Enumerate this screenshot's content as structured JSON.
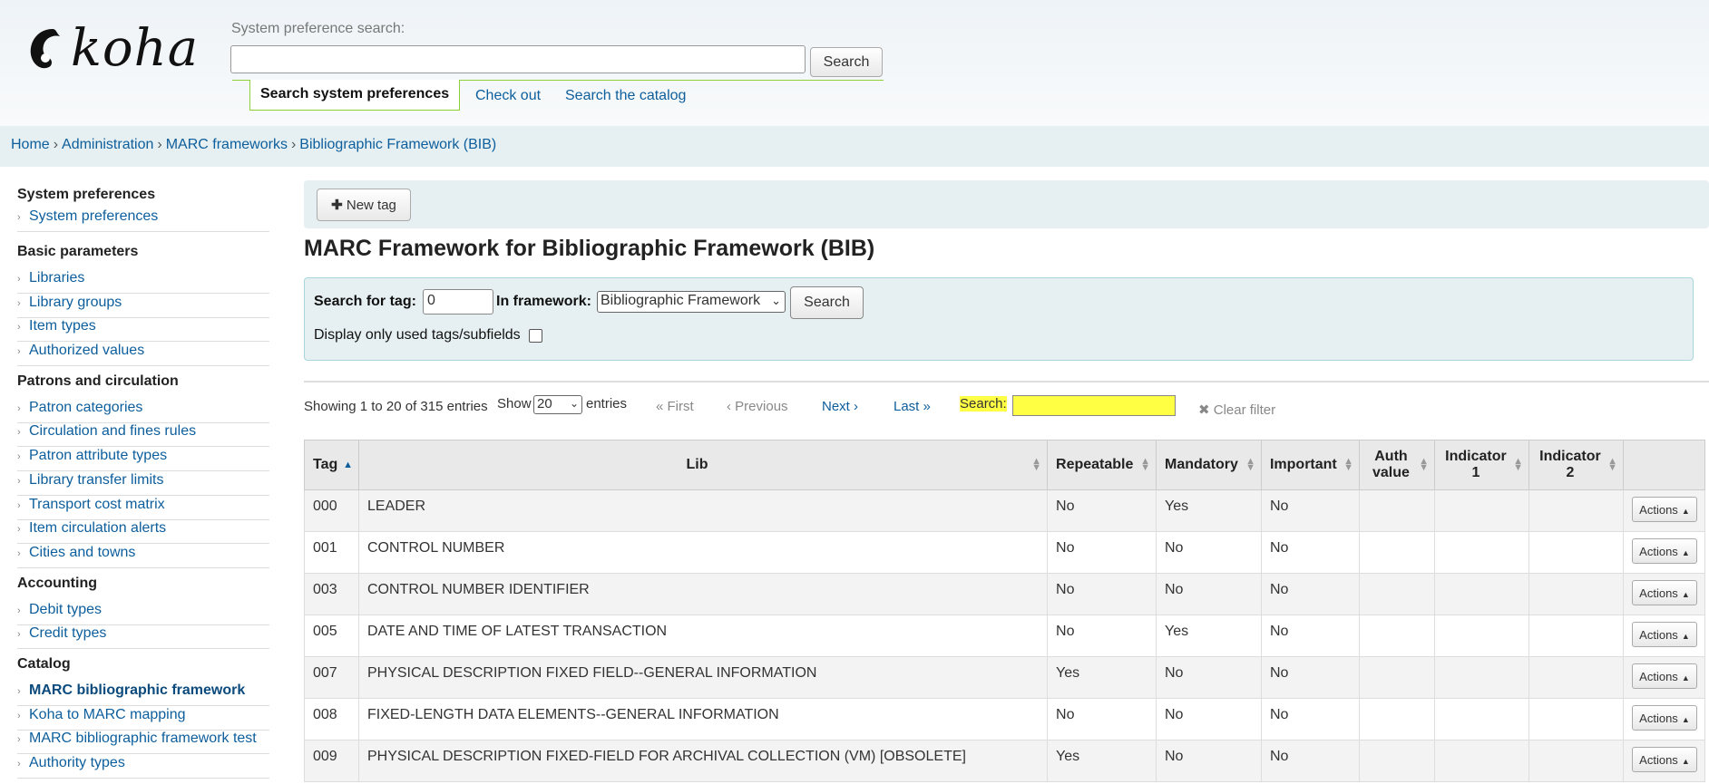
{
  "header": {
    "logo_text": "koha",
    "search_label": "System preference search:",
    "search_value": "",
    "search_button": "Search",
    "tabs": [
      {
        "label": "Search system preferences",
        "active": true
      },
      {
        "label": "Check out",
        "active": false
      },
      {
        "label": "Search the catalog",
        "active": false
      }
    ]
  },
  "breadcrumb": [
    "Home",
    "Administration",
    "MARC frameworks",
    "Bibliographic Framework (BIB)"
  ],
  "sidebar": {
    "sections": [
      {
        "heading": "System preferences",
        "items": [
          "System preferences"
        ]
      },
      {
        "heading": "Basic parameters",
        "items": [
          "Libraries",
          "Library groups",
          "Item types",
          "Authorized values"
        ]
      },
      {
        "heading": "Patrons and circulation",
        "items": [
          "Patron categories",
          "Circulation and fines rules",
          "Patron attribute types",
          "Library transfer limits",
          "Transport cost matrix",
          "Item circulation alerts",
          "Cities and towns"
        ]
      },
      {
        "heading": "Accounting",
        "items": [
          "Debit types",
          "Credit types"
        ]
      },
      {
        "heading": "Catalog",
        "items": [
          "MARC bibliographic framework",
          "Koha to MARC mapping",
          "MARC bibliographic framework test",
          "Authority types"
        ]
      }
    ],
    "active_item": "MARC bibliographic framework"
  },
  "toolbar": {
    "new_tag": "New tag"
  },
  "page_title": "MARC Framework for Bibliographic Framework (BIB)",
  "search_form": {
    "tag_label": "Search for tag:",
    "tag_value": "0",
    "framework_label": "In framework:",
    "framework_value": "Bibliographic Framework",
    "search_button": "Search",
    "display_used_label": "Display only used tags/subfields",
    "display_used_checked": false
  },
  "datatable": {
    "info": "Showing 1 to 20 of 315 entries",
    "show_label": "Show",
    "length_value": "20",
    "entries_label": "entries",
    "first": "First",
    "previous": "Previous",
    "next": "Next",
    "last": "Last",
    "search_label": "Search:",
    "search_value": "",
    "clear_filter": "Clear filter"
  },
  "table": {
    "columns": [
      "Tag",
      "Lib",
      "Repeatable",
      "Mandatory",
      "Important",
      "Auth value",
      "Indicator 1",
      "Indicator 2",
      ""
    ],
    "action_label": "Actions",
    "rows": [
      {
        "tag": "000",
        "lib": "LEADER",
        "repeatable": "No",
        "mandatory": "Yes",
        "important": "No",
        "auth": "",
        "ind1": "",
        "ind2": ""
      },
      {
        "tag": "001",
        "lib": "CONTROL NUMBER",
        "repeatable": "No",
        "mandatory": "No",
        "important": "No",
        "auth": "",
        "ind1": "",
        "ind2": ""
      },
      {
        "tag": "003",
        "lib": "CONTROL NUMBER IDENTIFIER",
        "repeatable": "No",
        "mandatory": "No",
        "important": "No",
        "auth": "",
        "ind1": "",
        "ind2": ""
      },
      {
        "tag": "005",
        "lib": "DATE AND TIME OF LATEST TRANSACTION",
        "repeatable": "No",
        "mandatory": "Yes",
        "important": "No",
        "auth": "",
        "ind1": "",
        "ind2": ""
      },
      {
        "tag": "007",
        "lib": "PHYSICAL DESCRIPTION FIXED FIELD--GENERAL INFORMATION",
        "repeatable": "Yes",
        "mandatory": "No",
        "important": "No",
        "auth": "",
        "ind1": "",
        "ind2": ""
      },
      {
        "tag": "008",
        "lib": "FIXED-LENGTH DATA ELEMENTS--GENERAL INFORMATION",
        "repeatable": "No",
        "mandatory": "No",
        "important": "No",
        "auth": "",
        "ind1": "",
        "ind2": ""
      },
      {
        "tag": "009",
        "lib": "PHYSICAL DESCRIPTION FIXED-FIELD FOR ARCHIVAL COLLECTION (VM) [OBSOLETE]",
        "repeatable": "Yes",
        "mandatory": "No",
        "important": "No",
        "auth": "",
        "ind1": "",
        "ind2": ""
      }
    ]
  },
  "colors": {
    "link": "#0d5e9c",
    "highlight": "#ffff44",
    "panel": "#e6f0f2",
    "tab_border": "#8fcf3c"
  }
}
